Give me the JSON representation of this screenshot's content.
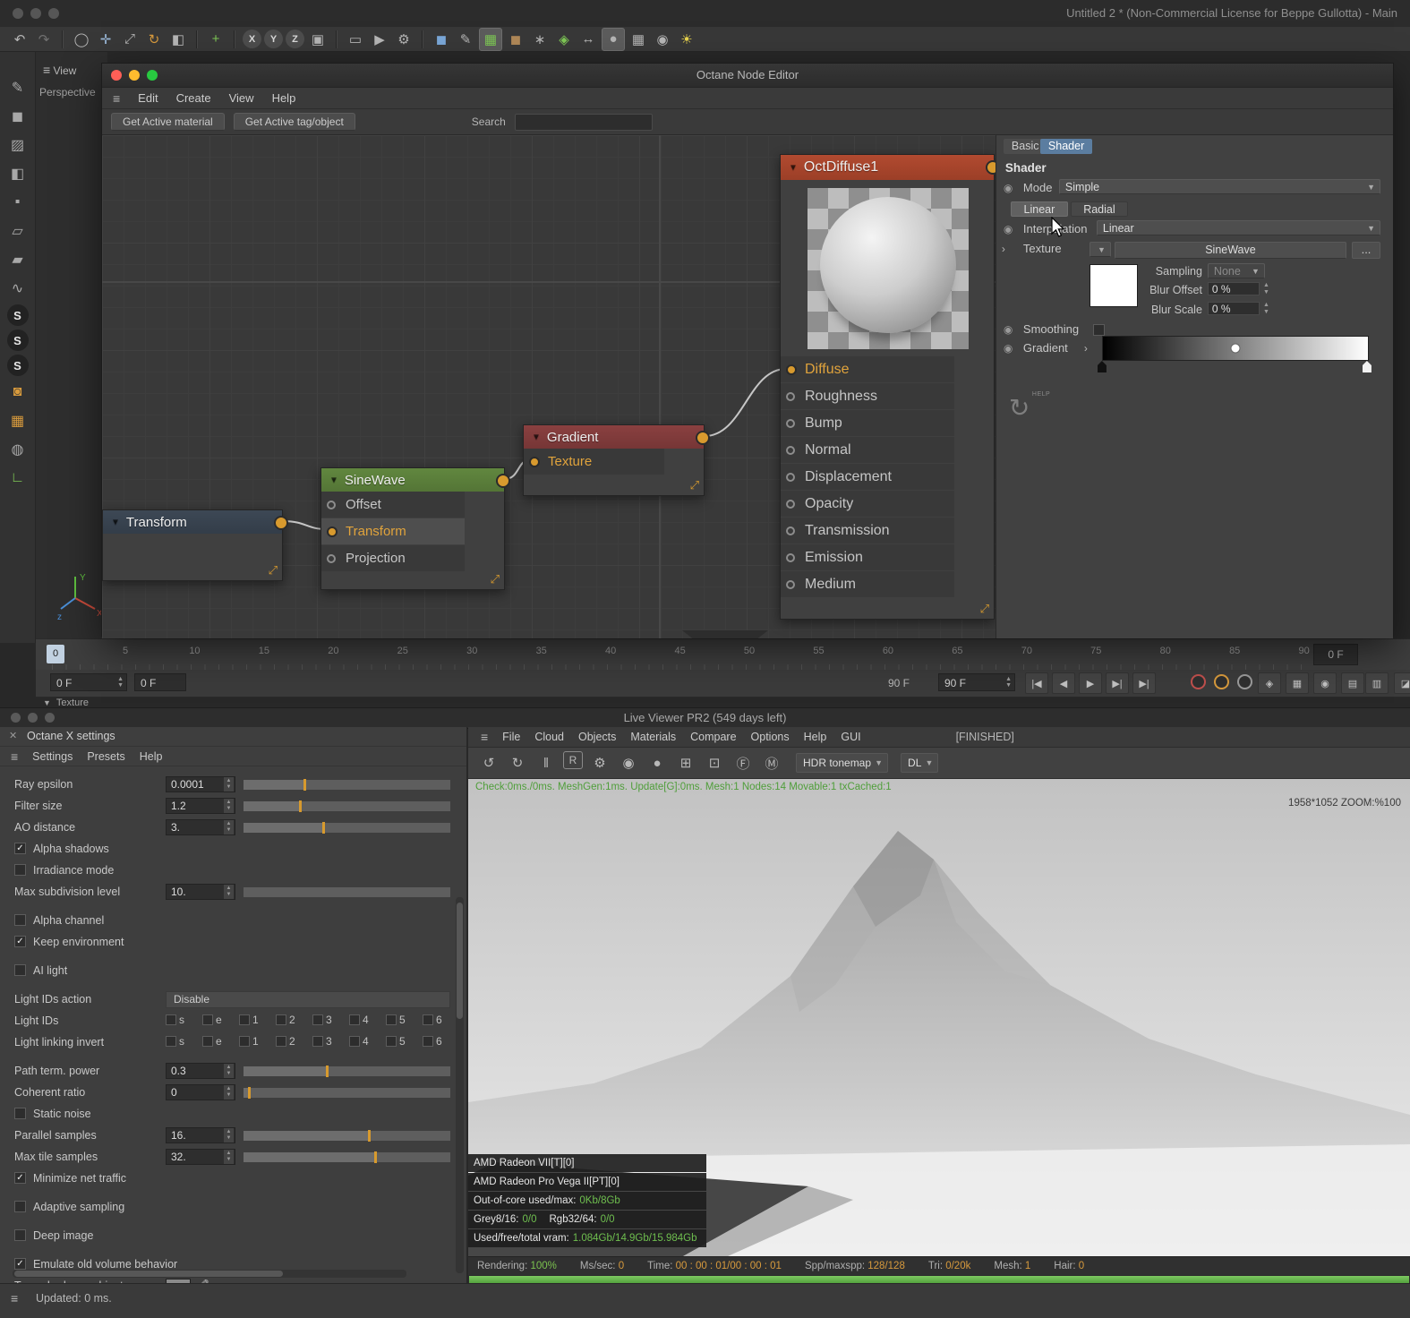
{
  "main_window": {
    "title": "Untitled 2 * (Non-Commercial License for Beppe Gullotta) - Main",
    "toolbar_icons": [
      {
        "name": "undo-icon",
        "glyph": "↶"
      },
      {
        "name": "redo-icon",
        "glyph": "↷",
        "dim": true
      },
      {
        "sep": true
      },
      {
        "name": "live-selection-icon",
        "glyph": "◯"
      },
      {
        "name": "move-tool-icon",
        "glyph": "✛",
        "color": "#9ab8d8"
      },
      {
        "name": "scale-tool-icon",
        "glyph": "⤢"
      },
      {
        "name": "rotate-tool-icon",
        "glyph": "↻",
        "color": "#d79a3d"
      },
      {
        "name": "last-used-tool-icon",
        "glyph": "◧"
      },
      {
        "sep": true
      },
      {
        "name": "add-object-icon",
        "glyph": "+",
        "color": "#7ec855"
      },
      {
        "sep": true
      },
      {
        "name": "lock-x-axis-icon",
        "glyph": "X",
        "circle": true
      },
      {
        "name": "lock-y-axis-icon",
        "glyph": "Y",
        "circle": true
      },
      {
        "name": "lock-z-axis-icon",
        "glyph": "Z",
        "circle": true
      },
      {
        "name": "coordinate-system-icon",
        "glyph": "▣"
      },
      {
        "sep": true
      },
      {
        "name": "render-view-icon",
        "glyph": "▭"
      },
      {
        "name": "render-to-picture-icon",
        "glyph": "▶"
      },
      {
        "name": "render-settings-icon",
        "glyph": "⚙"
      },
      {
        "sep": true
      },
      {
        "name": "cube-object-icon",
        "glyph": "◼",
        "color": "#7aa7d8"
      },
      {
        "name": "pen-object-icon",
        "glyph": "✎"
      },
      {
        "name": "mograph-icon",
        "glyph": "▦",
        "color": "#7ec855",
        "selected": true
      },
      {
        "name": "volume-icon",
        "glyph": "◼",
        "color": "#b08858"
      },
      {
        "name": "simulate-icon",
        "glyph": "∗"
      },
      {
        "name": "cluster-icon",
        "glyph": "◈",
        "color": "#7ec855"
      },
      {
        "name": "measure-icon",
        "glyph": "↔"
      },
      {
        "name": "sphere-object-icon",
        "glyph": "●",
        "selected": true
      },
      {
        "name": "floor-grid-icon",
        "glyph": "▦"
      },
      {
        "name": "camera-icon",
        "glyph": "◉"
      },
      {
        "name": "light-icon",
        "glyph": "☀",
        "color": "#e8d44d"
      }
    ]
  },
  "left_toolbar_icons": [
    {
      "name": "pen-tool-icon",
      "glyph": "✎"
    },
    {
      "name": "model-mode-icon",
      "glyph": "◼"
    },
    {
      "name": "texture-mode-icon",
      "glyph": "▨"
    },
    {
      "name": "workplane-mode-icon",
      "glyph": "◧"
    },
    {
      "name": "points-mode-icon",
      "glyph": "▪"
    },
    {
      "name": "edges-mode-icon",
      "glyph": "▱"
    },
    {
      "name": "polygons-mode-icon",
      "glyph": "▰"
    },
    {
      "name": "spline-tool-icon",
      "glyph": "∿"
    },
    {
      "name": "material-tag-icon",
      "glyph": "S",
      "circle": true
    },
    {
      "name": "material-tag-icon-2",
      "glyph": "S",
      "circle": true
    },
    {
      "name": "material-tag-icon-3",
      "glyph": "S",
      "circle": true
    },
    {
      "name": "paint-material-icon",
      "glyph": "◙",
      "color": "#d79a3d"
    },
    {
      "name": "uv-grid-icon",
      "glyph": "▦",
      "color": "#d79a3d"
    },
    {
      "name": "checker-ball-icon",
      "glyph": "◍"
    },
    {
      "name": "axis-mode-icon",
      "glyph": "∟",
      "color": "#7ec855"
    }
  ],
  "viewport": {
    "menu": "View",
    "camera_label": "Perspective"
  },
  "node_editor": {
    "title": "Octane Node Editor",
    "menus": [
      "Edit",
      "Create",
      "View",
      "Help"
    ],
    "get_active_material": "Get Active material",
    "get_active_tag": "Get Active tag/object",
    "search_label": "Search",
    "nodes": {
      "transform": {
        "title": "Transform"
      },
      "sinewave": {
        "title": "SineWave",
        "ports": [
          {
            "label": "Offset"
          },
          {
            "label": "Transform",
            "connected": true,
            "highlight": true
          },
          {
            "label": "Projection"
          }
        ]
      },
      "gradient": {
        "title": "Gradient",
        "ports": [
          {
            "label": "Texture",
            "connected": true,
            "highlight": true
          }
        ]
      },
      "octdiffuse": {
        "title": "OctDiffuse1",
        "ports": [
          {
            "label": "Diffuse",
            "connected": true,
            "highlight": true
          },
          {
            "label": "Roughness"
          },
          {
            "label": "Bump"
          },
          {
            "label": "Normal"
          },
          {
            "label": "Displacement"
          },
          {
            "label": "Opacity"
          },
          {
            "label": "Transmission"
          },
          {
            "label": "Emission"
          },
          {
            "label": "Medium"
          }
        ]
      }
    },
    "panel": {
      "tabs": [
        {
          "label": "Basic"
        },
        {
          "label": "Shader"
        }
      ],
      "heading": "Shader",
      "mode_label": "Mode",
      "mode_value": "Simple",
      "linear_button": "Linear",
      "radial_button": "Radial",
      "interpolation_label": "Interpolation",
      "interpolation_value": "Linear",
      "texture_label": "Texture",
      "texture_value": "SineWave",
      "more_button": "...",
      "sampling_label": "Sampling",
      "sampling_value": "None",
      "blur_offset_label": "Blur Offset",
      "blur_offset_value": "0 %",
      "blur_scale_label": "Blur Scale",
      "blur_scale_value": "0 %",
      "smoothing_label": "Smoothing",
      "gradient_label": "Gradient",
      "help_label": "HELP"
    }
  },
  "timeline": {
    "scrubber": "0",
    "tick_labels": [
      "5",
      "10",
      "15",
      "20",
      "25",
      "30",
      "35",
      "40",
      "45",
      "50",
      "55",
      "60",
      "65",
      "70",
      "75",
      "80",
      "85",
      "90"
    ],
    "frame_box": "0 F",
    "start_frame": "0 F",
    "current_frame": "0 F",
    "end_label": "90 F",
    "end_frame": "90 F",
    "transport": [
      {
        "name": "goto-start-button",
        "glyph": "|◀"
      },
      {
        "name": "prev-frame-button",
        "glyph": "◀"
      },
      {
        "name": "play-button",
        "glyph": "▶"
      },
      {
        "name": "next-frame-button",
        "glyph": "▶|"
      },
      {
        "name": "goto-end-button",
        "glyph": "▶|"
      }
    ],
    "record_buttons": [
      {
        "name": "record-active-button",
        "color": "#c0504d"
      },
      {
        "name": "autokey-button",
        "color": "#d79a3d"
      },
      {
        "name": "keyframe-selection-button",
        "color": "#9a9a9a"
      }
    ],
    "key_icons": [
      {
        "name": "record-position-button",
        "glyph": "◈"
      },
      {
        "name": "record-scale-button",
        "glyph": "▦"
      },
      {
        "name": "record-rotation-button",
        "glyph": "◉"
      },
      {
        "name": "record-parameter-button",
        "glyph": "▤"
      }
    ],
    "right_icons": [
      {
        "name": "keyframe-settings-button",
        "glyph": "▥"
      },
      {
        "name": "timeline-menu-button",
        "glyph": "◪"
      }
    ],
    "texture_track_label": "Texture"
  },
  "settings": {
    "title": "Octane X settings",
    "menus": [
      "Settings",
      "Presets",
      "Help"
    ],
    "rows": [
      {
        "type": "spin",
        "label": "Ray epsilon",
        "value": "0.0001",
        "pct": 29
      },
      {
        "type": "spin",
        "label": "Filter size",
        "value": "1.2",
        "pct": 27
      },
      {
        "type": "spin",
        "label": "AO distance",
        "value": "3.",
        "pct": 38
      },
      {
        "type": "check",
        "label": "Alpha shadows",
        "checked": true
      },
      {
        "type": "check",
        "label": "Irradiance mode",
        "checked": false
      },
      {
        "type": "spin",
        "label": "Max subdivision level",
        "value": "10.",
        "gap_after": true
      },
      {
        "type": "check",
        "label": "Alpha channel",
        "checked": false
      },
      {
        "type": "check",
        "label": "Keep environment",
        "checked": true,
        "gap_after": true
      },
      {
        "type": "check",
        "label": "AI light",
        "checked": false,
        "gap_after": true
      },
      {
        "type": "button",
        "label": "Light IDs action",
        "value": "Disable"
      },
      {
        "type": "checkgroup",
        "label": "Light IDs",
        "items": [
          "s",
          "e",
          "1",
          "2",
          "3",
          "4",
          "5",
          "6"
        ]
      },
      {
        "type": "checkgroup",
        "label": "Light linking invert",
        "items": [
          "s",
          "e",
          "1",
          "2",
          "3",
          "4",
          "5",
          "6"
        ],
        "gap_after": true
      },
      {
        "type": "spin",
        "label": "Path term. power",
        "value": "0.3",
        "pct": 40
      },
      {
        "type": "spin",
        "label": "Coherent ratio",
        "value": "0",
        "pct": 2
      },
      {
        "type": "check",
        "label": "Static noise",
        "checked": false
      },
      {
        "type": "spin",
        "label": "Parallel samples",
        "value": "16.",
        "pct": 60
      },
      {
        "type": "spin",
        "label": "Max tile samples",
        "value": "32.",
        "pct": 63
      },
      {
        "type": "check",
        "label": "Minimize net traffic",
        "checked": true,
        "gap_after": true
      },
      {
        "type": "check",
        "label": "Adaptive sampling",
        "checked": false,
        "gap_after": true
      },
      {
        "type": "check",
        "label": "Deep image",
        "checked": false,
        "gap_after": true
      },
      {
        "type": "check",
        "label": "Emulate old volume behavior",
        "checked": true
      },
      {
        "type": "color",
        "label": "Toon shadow ambient"
      }
    ],
    "updated": "Updated: 0 ms."
  },
  "live_viewer": {
    "title": "Live Viewer PR2 (549 days left)",
    "menus": [
      "File",
      "Cloud",
      "Objects",
      "Materials",
      "Compare",
      "Options",
      "Help",
      "GUI"
    ],
    "finished_badge": "[FINISHED]",
    "toolbar_icons": [
      {
        "name": "restart-render-icon",
        "glyph": "↺"
      },
      {
        "name": "refresh-icon",
        "glyph": "↻"
      },
      {
        "name": "pause-icon",
        "glyph": "‖"
      },
      {
        "name": "region-render-icon",
        "glyph": "R",
        "boxed": true
      },
      {
        "name": "render-settings-icon",
        "glyph": "⚙"
      },
      {
        "name": "lock-resolution-icon",
        "glyph": "◉"
      },
      {
        "name": "material-ball-icon",
        "glyph": "●"
      },
      {
        "name": "add-material-icon",
        "glyph": "⊞"
      },
      {
        "name": "pick-material-icon",
        "glyph": "⊡"
      },
      {
        "name": "focus-picker-icon",
        "glyph": "Ⓕ"
      },
      {
        "name": "material-picker-icon",
        "glyph": "Ⓜ"
      }
    ],
    "tonemap_dropdown": "HDR tonemap",
    "device_dropdown": "DL",
    "check_line": "Check:0ms./0ms. MeshGen:1ms. Update[G]:0ms. Mesh:1 Nodes:14 Movable:1 txCached:1",
    "resolution_line": "1958*1052 ZOOM:%100",
    "gpu_rows": [
      "AMD Radeon VII[T][0]",
      "AMD Radeon Pro Vega II[PT][0]"
    ],
    "stats_rows": [
      {
        "label": "Out-of-core used/max:",
        "value": "0Kb/8Gb"
      },
      {
        "label": "Grey8/16:",
        "value": "0/0",
        "label2": "Rgb32/64:",
        "value2": "0/0"
      },
      {
        "label": "Used/free/total vram:",
        "value": "1.084Gb/14.9Gb/15.984Gb"
      }
    ],
    "status_items": [
      {
        "label": "Rendering:",
        "value": "100%",
        "color": "#7bc24f"
      },
      {
        "label": "Ms/sec:",
        "value": "0"
      },
      {
        "label": "Time:",
        "value": "00 : 00 : 01/00 : 00 : 01"
      },
      {
        "label": "Spp/maxspp:",
        "value": "128/128"
      },
      {
        "label": "Tri:",
        "value": "0/20k"
      },
      {
        "label": "Mesh:",
        "value": "1"
      },
      {
        "label": "Hair:",
        "value": "0"
      }
    ]
  }
}
